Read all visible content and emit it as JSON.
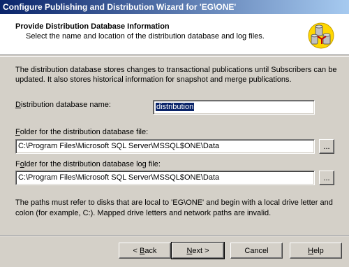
{
  "window": {
    "title": "Configure Publishing and Distribution Wizard for 'EG\\ONE'"
  },
  "header": {
    "title": "Provide Distribution Database Information",
    "subtitle": "Select the name and location of the distribution database and log files."
  },
  "intro": {
    "line1": "The distribution database stores changes to transactional publications until Subscribers can be",
    "line2": "updated. It also stores historical information for snapshot and merge publications."
  },
  "db_name": {
    "label_underlined": "D",
    "label_rest": "istribution database name:",
    "value": "distribution"
  },
  "db_folder": {
    "label_underlined": "F",
    "label_rest": "older for the distribution database file:",
    "value": "C:\\Program Files\\Microsoft SQL Server\\MSSQL$ONE\\Data",
    "browse": "..."
  },
  "log_folder": {
    "label_pre": "F",
    "label_underlined": "o",
    "label_rest": "lder for the distribution database log file:",
    "value": "C:\\Program Files\\Microsoft SQL Server\\MSSQL$ONE\\Data",
    "browse": "..."
  },
  "note": {
    "line1": "The paths must refer to disks that are local to 'EG\\ONE' and begin with a local drive letter and",
    "line2": "colon (for example, C:). Mapped drive letters and network paths are invalid."
  },
  "buttons": {
    "back_arrow": "<",
    "back_underlined": "B",
    "back_rest": "ack",
    "next_underlined": "N",
    "next_rest": "ext >",
    "cancel": "Cancel",
    "help_underlined": "H",
    "help_rest": "elp"
  }
}
